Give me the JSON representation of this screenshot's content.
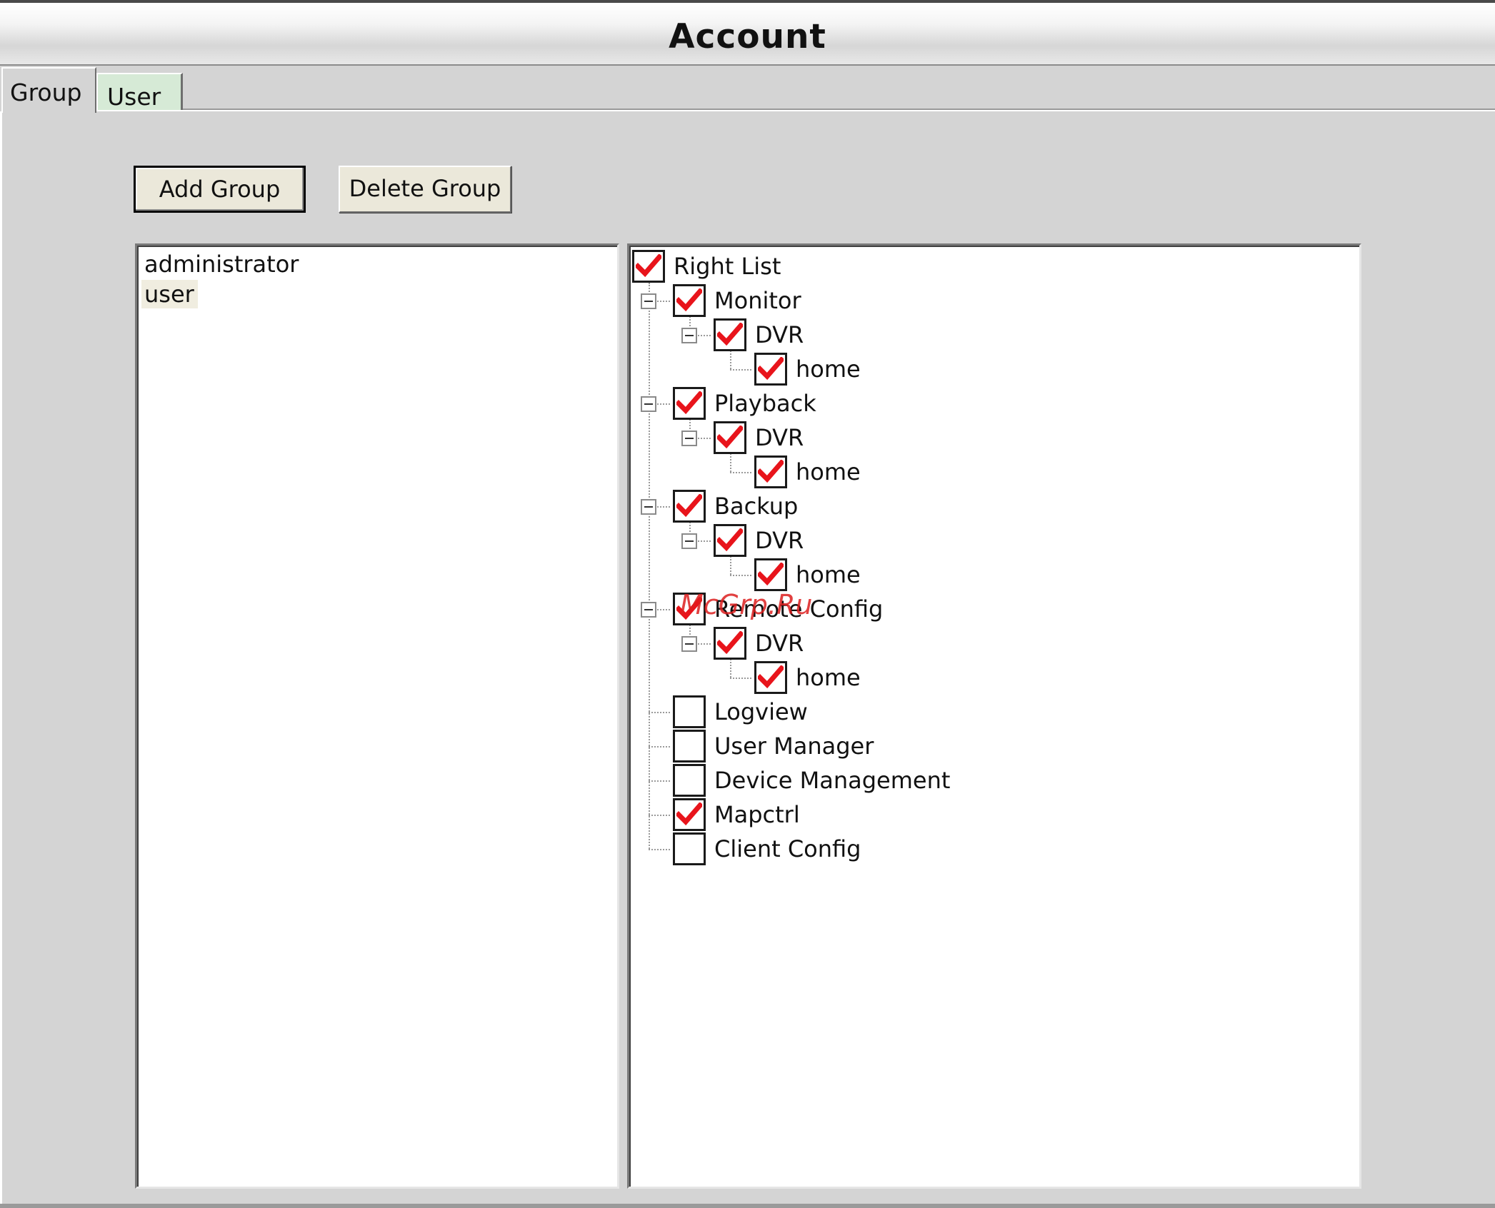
{
  "window": {
    "title": "Account"
  },
  "tabs": [
    {
      "label": "Group",
      "active": true
    },
    {
      "label": "User",
      "active": false
    }
  ],
  "toolbar": {
    "add_group_label": "Add Group",
    "delete_group_label": "Delete Group"
  },
  "groups": {
    "items": [
      {
        "name": "administrator",
        "selected": false
      },
      {
        "name": "user",
        "selected": true
      }
    ]
  },
  "rights": {
    "root": {
      "label": "Right List",
      "checked": true
    },
    "items": [
      {
        "label": "Monitor",
        "checked": true
      },
      {
        "label": "DVR",
        "checked": true
      },
      {
        "label": "home",
        "checked": true
      },
      {
        "label": "Playback",
        "checked": true
      },
      {
        "label": "DVR",
        "checked": true
      },
      {
        "label": "home",
        "checked": true
      },
      {
        "label": "Backup",
        "checked": true
      },
      {
        "label": "DVR",
        "checked": true
      },
      {
        "label": "home",
        "checked": true
      },
      {
        "label": "Remote Config",
        "checked": true
      },
      {
        "label": "DVR",
        "checked": true
      },
      {
        "label": "home",
        "checked": true
      },
      {
        "label": "Logview",
        "checked": false
      },
      {
        "label": "User Manager",
        "checked": false
      },
      {
        "label": "Device Management",
        "checked": false
      },
      {
        "label": "Mapctrl",
        "checked": true
      },
      {
        "label": "Client Config",
        "checked": false
      }
    ]
  },
  "watermark": "McGrp.Ru",
  "colors": {
    "check_mark": "#e8141b",
    "panel_background": "#d4d4d4",
    "user_tab": "#d6ead6"
  }
}
